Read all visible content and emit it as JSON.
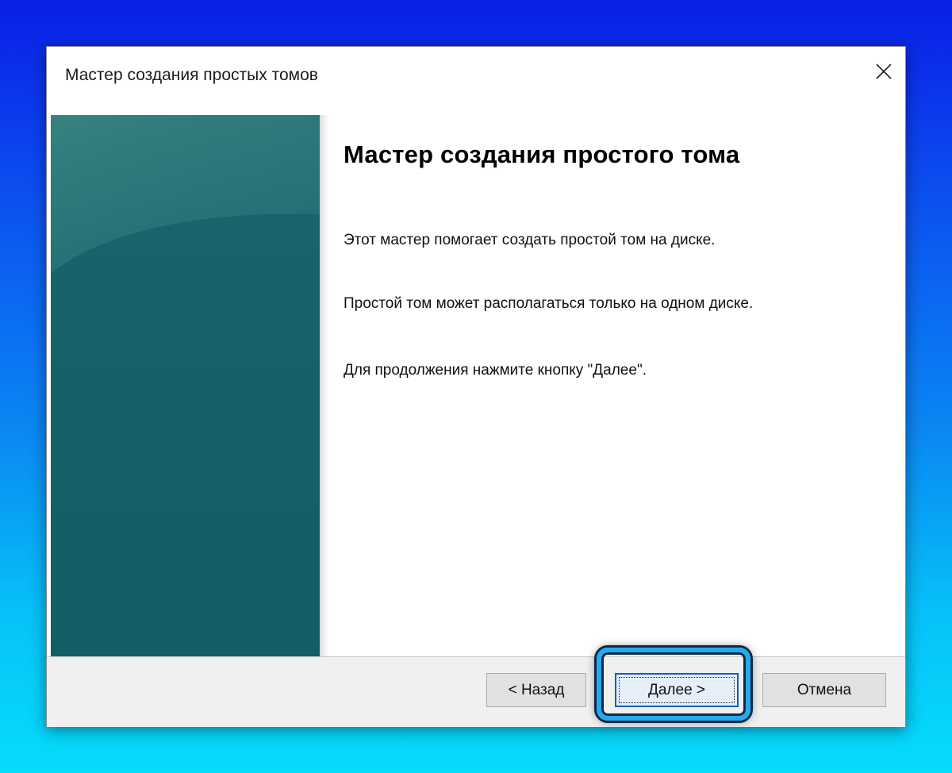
{
  "window": {
    "title": "Мастер создания простых томов"
  },
  "main": {
    "heading": "Мастер создания простого тома",
    "paragraph1": "Этот мастер помогает создать простой том на диске.",
    "paragraph2": "Простой том может располагаться только на одном диске.",
    "paragraph3": "Для продолжения нажмите кнопку \"Далее\"."
  },
  "buttons": {
    "back_label": "< Назад",
    "next_label": "Далее >",
    "cancel_label": "Отмена"
  },
  "icons": {
    "close": "close-icon"
  },
  "colors": {
    "background_top": "#0a1ee6",
    "background_bottom": "#05dcfb",
    "side_panel": "#145f6b",
    "highlight": "#27a9ee"
  }
}
